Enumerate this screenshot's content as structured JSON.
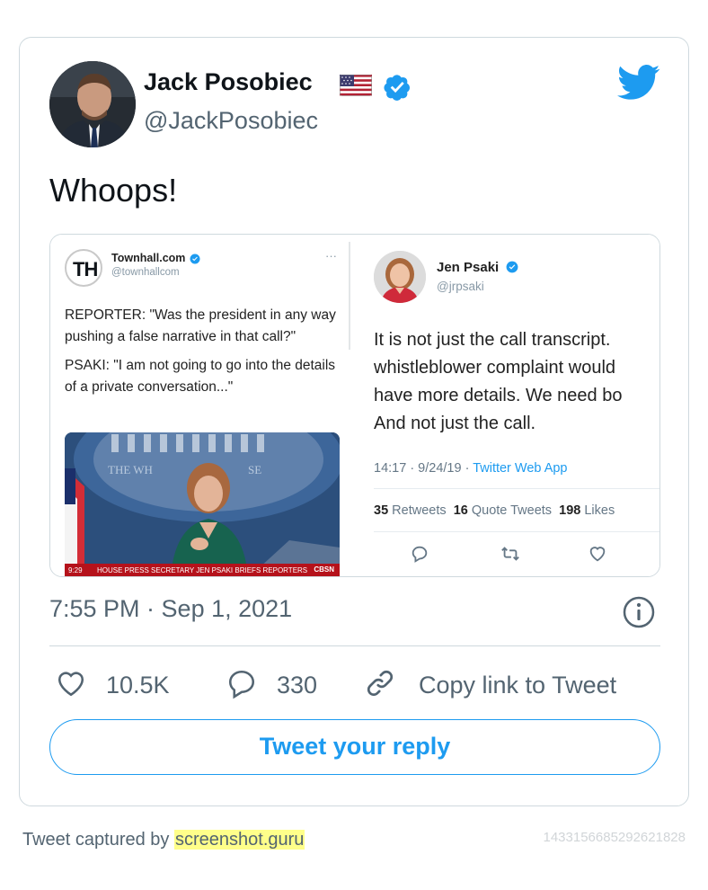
{
  "author": {
    "name": "Jack Posobiec",
    "handle": "@JackPosobiec"
  },
  "icons": {
    "flag": "us-flag-icon",
    "verified": "verified-badge-icon",
    "brand": "twitter-bird-icon",
    "info": "info-icon",
    "like": "heart-icon",
    "reply": "speech-bubble-icon",
    "copy": "link-icon"
  },
  "tweet": {
    "text": "Whoops!",
    "timestamp": "7:55 PM · Sep 1, 2021"
  },
  "media": {
    "left_tweet": {
      "name": "Townhall.com",
      "handle": "@townhallcom",
      "logo_text": "TH",
      "more": "···",
      "body": [
        "REPORTER: \"Was the president in any way pushing a false narrative in that call?\"",
        "PSAKI: \"I am not going to go into the details of a private conversation...\""
      ],
      "video_chyron": "HOUSE PRESS SECRETARY JEN PSAKI BRIEFS REPORTERS",
      "video_time": "9:29",
      "video_network": "CBSN"
    },
    "right_tweet": {
      "name": "Jen Psaki",
      "handle": "@jrpsaki",
      "body_lines": [
        "It is not just the call transcript.",
        "whistleblower complaint would",
        "have more details.  We need bo",
        "And not just the call."
      ],
      "time": "14:17 · 9/24/19 · ",
      "app": "Twitter Web App",
      "retweets_count": "35",
      "retweets_label": "Retweets",
      "quotes_count": "16",
      "quotes_label": "Quote Tweets",
      "likes_count": "198",
      "likes_label": "Likes"
    }
  },
  "actions": {
    "likes": "10.5K",
    "replies": "330",
    "copy_link": "Copy link to Tweet"
  },
  "reply_button": "Tweet your reply",
  "footer": {
    "prefix": "Tweet captured by ",
    "link": "screenshot.guru",
    "tweet_id": "1433156685292621828"
  },
  "colors": {
    "brand_blue": "#1d9bf0",
    "secondary_text": "#536471",
    "border": "#cfd9de",
    "highlight": "#ffff8a"
  }
}
